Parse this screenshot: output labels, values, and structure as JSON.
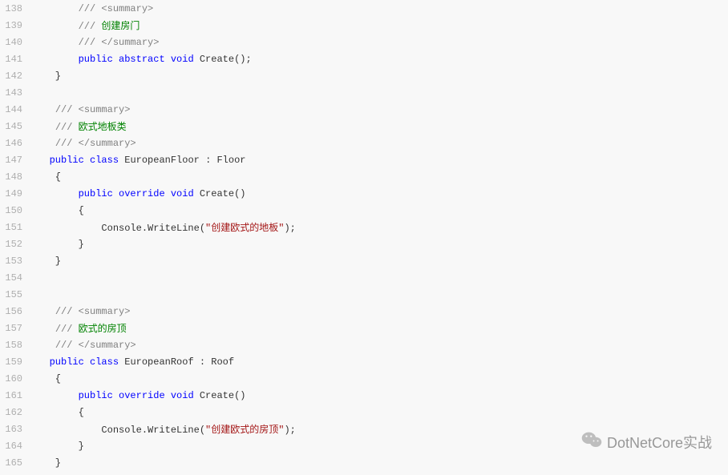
{
  "startLine": 138,
  "watermark": {
    "text": "DotNetCore实战"
  },
  "lines": [
    {
      "n": 138,
      "tokens": [
        {
          "t": "        ",
          "c": "plain"
        },
        {
          "t": "///",
          "c": "gray"
        },
        {
          "t": " ",
          "c": "comment"
        },
        {
          "t": "<summary>",
          "c": "gray"
        }
      ]
    },
    {
      "n": 139,
      "tokens": [
        {
          "t": "        ",
          "c": "plain"
        },
        {
          "t": "///",
          "c": "gray"
        },
        {
          "t": " 创建房门",
          "c": "comment"
        }
      ]
    },
    {
      "n": 140,
      "tokens": [
        {
          "t": "        ",
          "c": "plain"
        },
        {
          "t": "///",
          "c": "gray"
        },
        {
          "t": " ",
          "c": "comment"
        },
        {
          "t": "</summary>",
          "c": "gray"
        }
      ]
    },
    {
      "n": 141,
      "tokens": [
        {
          "t": "        ",
          "c": "plain"
        },
        {
          "t": "public",
          "c": "keyword"
        },
        {
          "t": " ",
          "c": "plain"
        },
        {
          "t": "abstract",
          "c": "keyword"
        },
        {
          "t": " ",
          "c": "plain"
        },
        {
          "t": "void",
          "c": "keyword"
        },
        {
          "t": " Create();",
          "c": "plain"
        }
      ]
    },
    {
      "n": 142,
      "tokens": [
        {
          "t": "    }",
          "c": "plain"
        }
      ]
    },
    {
      "n": 143,
      "tokens": []
    },
    {
      "n": 144,
      "tokens": [
        {
          "t": "    ",
          "c": "plain"
        },
        {
          "t": "///",
          "c": "gray"
        },
        {
          "t": " ",
          "c": "comment"
        },
        {
          "t": "<summary>",
          "c": "gray"
        }
      ]
    },
    {
      "n": 145,
      "tokens": [
        {
          "t": "    ",
          "c": "plain"
        },
        {
          "t": "///",
          "c": "gray"
        },
        {
          "t": " 欧式地板类",
          "c": "comment"
        }
      ]
    },
    {
      "n": 146,
      "tokens": [
        {
          "t": "    ",
          "c": "plain"
        },
        {
          "t": "///",
          "c": "gray"
        },
        {
          "t": " ",
          "c": "comment"
        },
        {
          "t": "</summary>",
          "c": "gray"
        }
      ]
    },
    {
      "n": 147,
      "tokens": [
        {
          "t": "   ",
          "c": "plain"
        },
        {
          "t": "public",
          "c": "keyword"
        },
        {
          "t": " ",
          "c": "plain"
        },
        {
          "t": "class",
          "c": "keyword"
        },
        {
          "t": " EuropeanFloor : Floor",
          "c": "plain"
        }
      ]
    },
    {
      "n": 148,
      "tokens": [
        {
          "t": "    {",
          "c": "plain"
        }
      ]
    },
    {
      "n": 149,
      "tokens": [
        {
          "t": "        ",
          "c": "plain"
        },
        {
          "t": "public",
          "c": "keyword"
        },
        {
          "t": " ",
          "c": "plain"
        },
        {
          "t": "override",
          "c": "keyword"
        },
        {
          "t": " ",
          "c": "plain"
        },
        {
          "t": "void",
          "c": "keyword"
        },
        {
          "t": " Create()",
          "c": "plain"
        }
      ]
    },
    {
      "n": 150,
      "tokens": [
        {
          "t": "        {",
          "c": "plain"
        }
      ]
    },
    {
      "n": 151,
      "tokens": [
        {
          "t": "            Console.WriteLine(",
          "c": "plain"
        },
        {
          "t": "\"创建欧式的地板\"",
          "c": "string"
        },
        {
          "t": ");",
          "c": "plain"
        }
      ]
    },
    {
      "n": 152,
      "tokens": [
        {
          "t": "        }",
          "c": "plain"
        }
      ]
    },
    {
      "n": 153,
      "tokens": [
        {
          "t": "    }",
          "c": "plain"
        }
      ]
    },
    {
      "n": 154,
      "tokens": []
    },
    {
      "n": 155,
      "tokens": []
    },
    {
      "n": 156,
      "tokens": [
        {
          "t": "    ",
          "c": "plain"
        },
        {
          "t": "///",
          "c": "gray"
        },
        {
          "t": " ",
          "c": "comment"
        },
        {
          "t": "<summary>",
          "c": "gray"
        }
      ]
    },
    {
      "n": 157,
      "tokens": [
        {
          "t": "    ",
          "c": "plain"
        },
        {
          "t": "///",
          "c": "gray"
        },
        {
          "t": " 欧式的房顶",
          "c": "comment"
        }
      ]
    },
    {
      "n": 158,
      "tokens": [
        {
          "t": "    ",
          "c": "plain"
        },
        {
          "t": "///",
          "c": "gray"
        },
        {
          "t": " ",
          "c": "comment"
        },
        {
          "t": "</summary>",
          "c": "gray"
        }
      ]
    },
    {
      "n": 159,
      "tokens": [
        {
          "t": "   ",
          "c": "plain"
        },
        {
          "t": "public",
          "c": "keyword"
        },
        {
          "t": " ",
          "c": "plain"
        },
        {
          "t": "class",
          "c": "keyword"
        },
        {
          "t": " EuropeanRoof : Roof",
          "c": "plain"
        }
      ]
    },
    {
      "n": 160,
      "tokens": [
        {
          "t": "    {",
          "c": "plain"
        }
      ]
    },
    {
      "n": 161,
      "tokens": [
        {
          "t": "        ",
          "c": "plain"
        },
        {
          "t": "public",
          "c": "keyword"
        },
        {
          "t": " ",
          "c": "plain"
        },
        {
          "t": "override",
          "c": "keyword"
        },
        {
          "t": " ",
          "c": "plain"
        },
        {
          "t": "void",
          "c": "keyword"
        },
        {
          "t": " Create()",
          "c": "plain"
        }
      ]
    },
    {
      "n": 162,
      "tokens": [
        {
          "t": "        {",
          "c": "plain"
        }
      ]
    },
    {
      "n": 163,
      "tokens": [
        {
          "t": "            Console.WriteLine(",
          "c": "plain"
        },
        {
          "t": "\"创建欧式的房顶\"",
          "c": "string"
        },
        {
          "t": ");",
          "c": "plain"
        }
      ]
    },
    {
      "n": 164,
      "tokens": [
        {
          "t": "        }",
          "c": "plain"
        }
      ]
    },
    {
      "n": 165,
      "tokens": [
        {
          "t": "    }",
          "c": "plain"
        }
      ]
    }
  ]
}
